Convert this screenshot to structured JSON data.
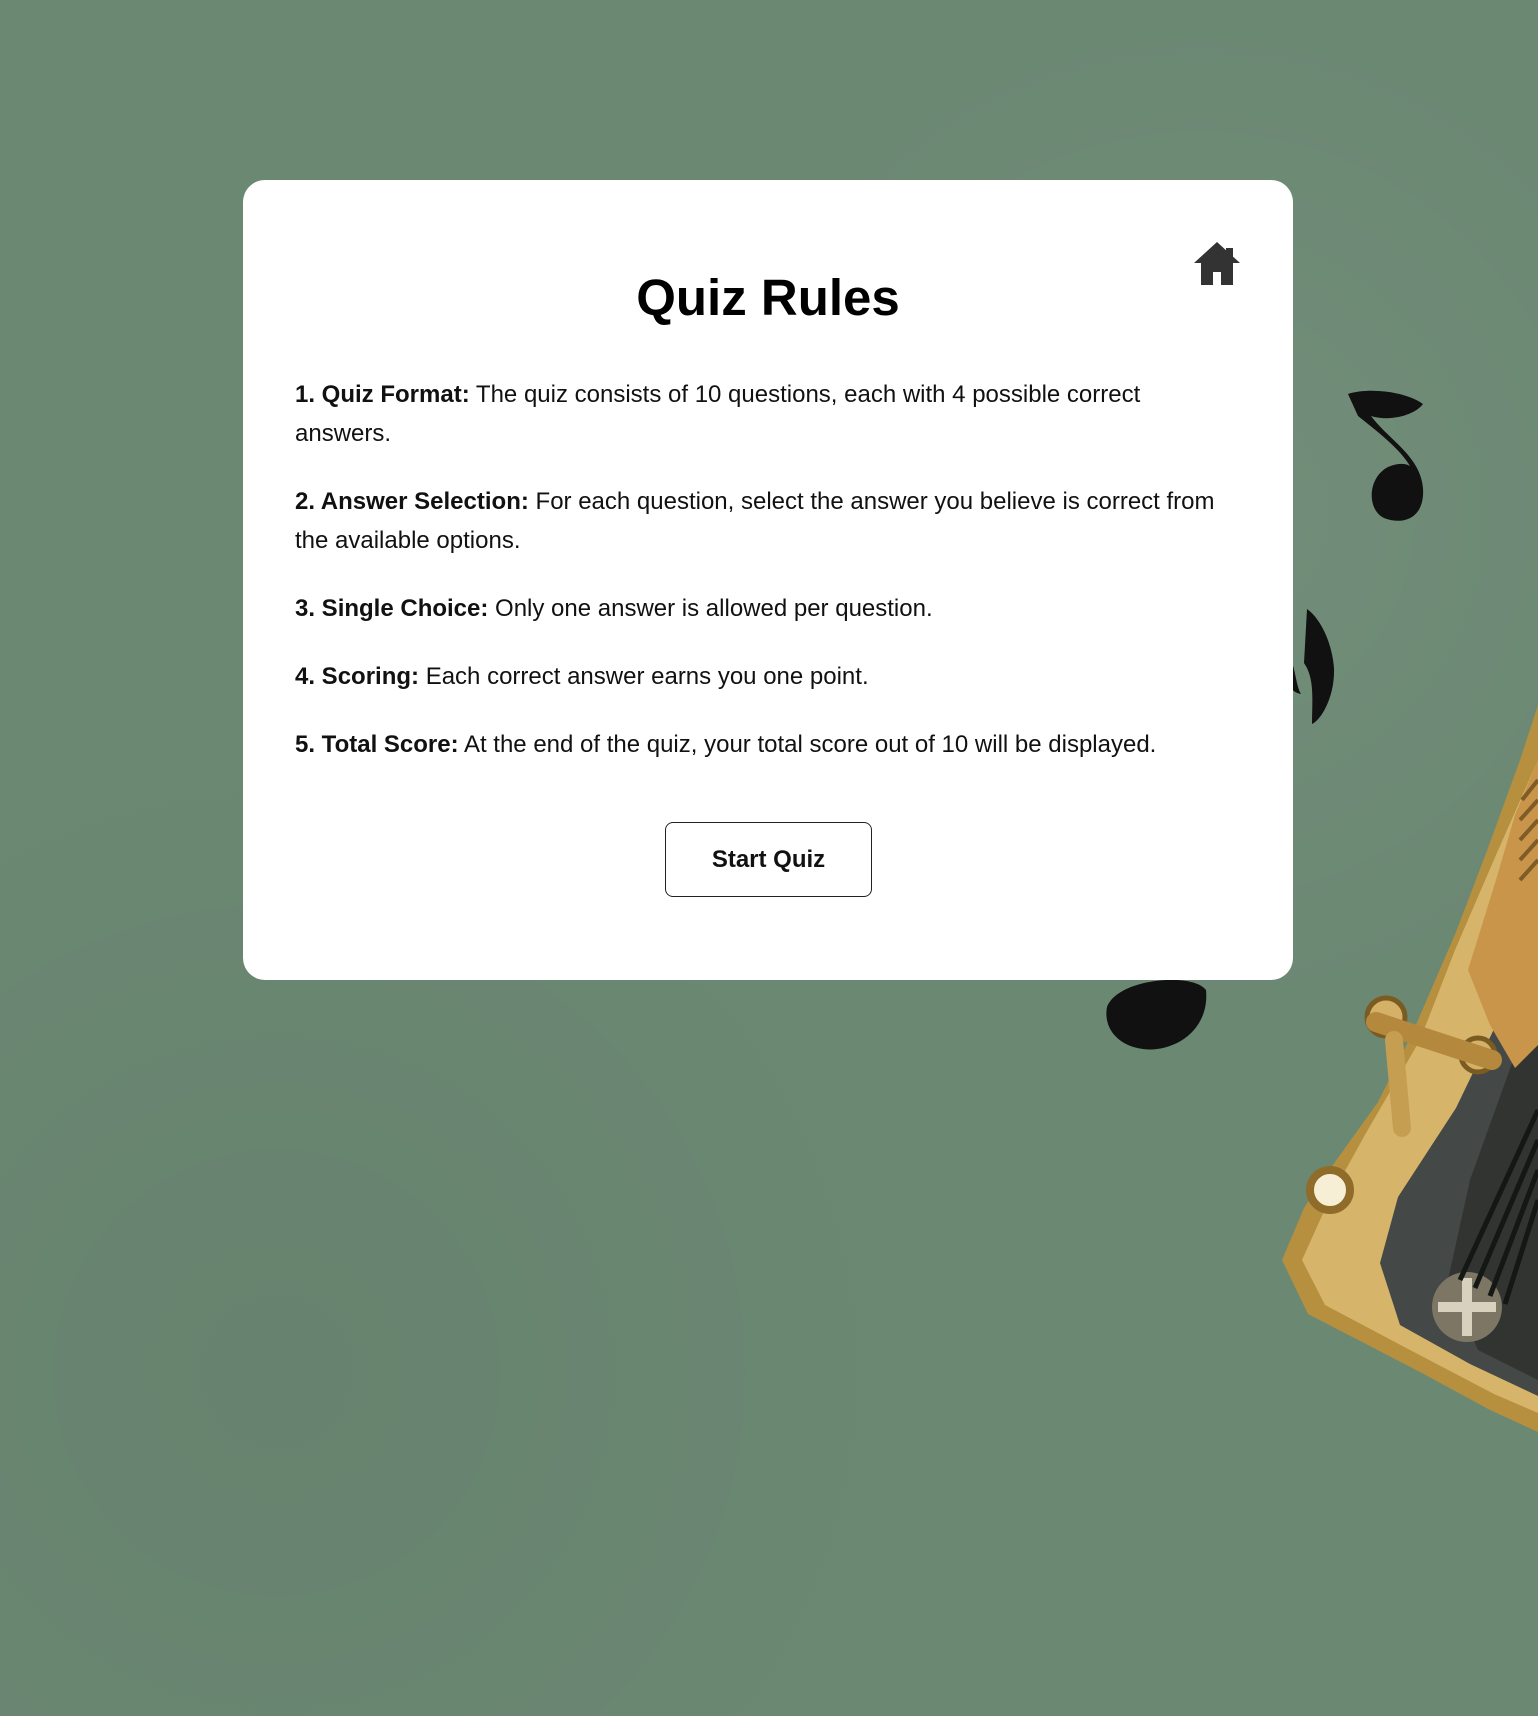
{
  "page": {
    "background_color": "#6b8873",
    "card_color": "#ffffff"
  },
  "header": {
    "title": "Quiz Rules",
    "home_icon": "home-icon"
  },
  "rules": [
    {
      "label": "1. Quiz Format:",
      "text": " The quiz consists of 10 questions, each with 4 possible correct answers."
    },
    {
      "label": "2. Answer Selection:",
      "text": " For each question, select the answer you believe is correct from the available options."
    },
    {
      "label": "3. Single Choice:",
      "text": " Only one answer is allowed per question."
    },
    {
      "label": "4. Scoring:",
      "text": " Each correct answer earns you one point."
    },
    {
      "label": "5. Total Score:",
      "text": " At the end of the quiz, your total score out of 10 will be displayed."
    }
  ],
  "actions": {
    "start_label": "Start Quiz"
  }
}
